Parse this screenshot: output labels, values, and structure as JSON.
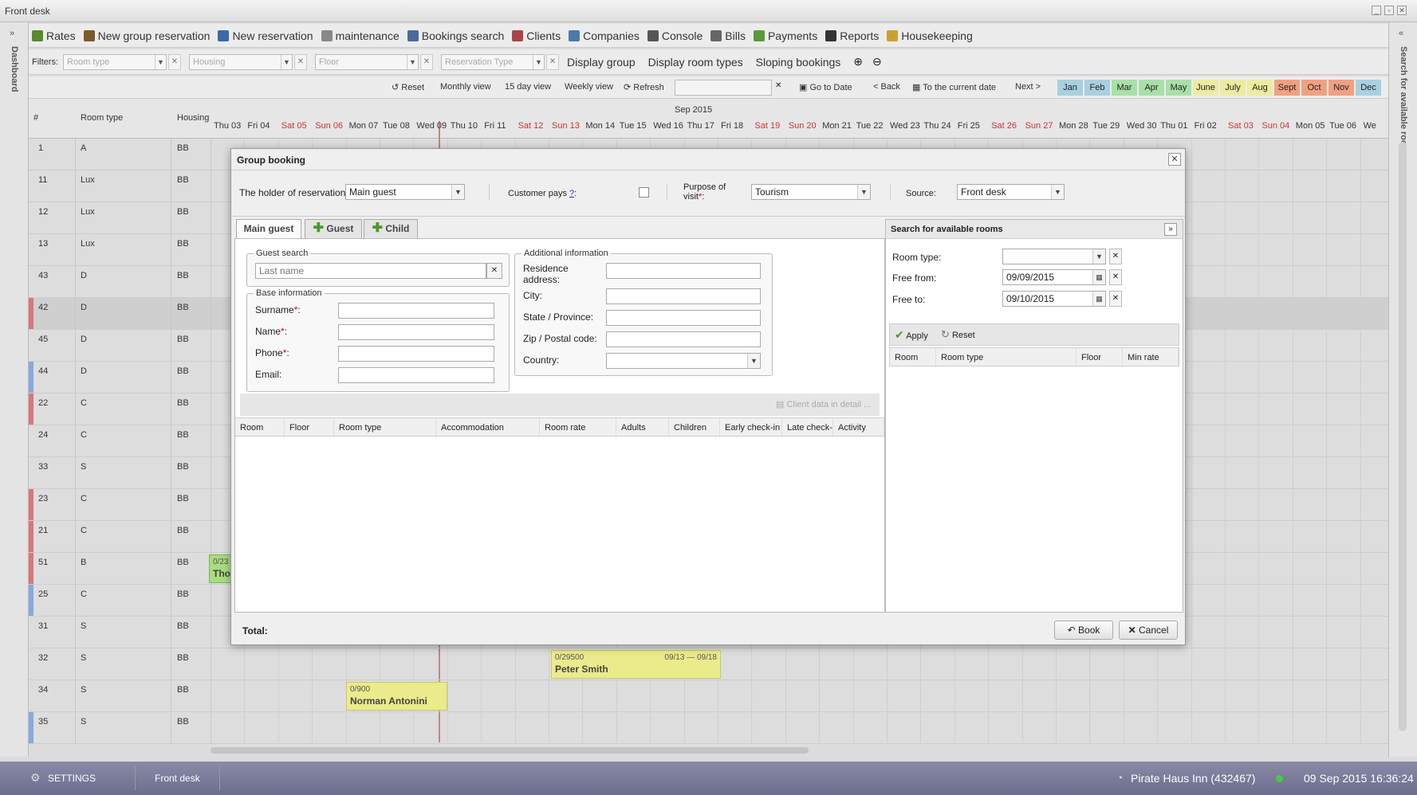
{
  "window": {
    "title": "Front desk"
  },
  "sidebars": {
    "left_label": "Dashboard",
    "right_label": "Search for available rooms"
  },
  "toolbar": {
    "items": [
      {
        "label": "Rates",
        "icon": "rates-icon",
        "color": "#5a8a2a"
      },
      {
        "label": "New group reservation",
        "icon": "group-icon",
        "color": "#7a5a2a"
      },
      {
        "label": "New reservation",
        "icon": "pen-icon",
        "color": "#3a6aaa"
      },
      {
        "label": "maintenance",
        "icon": "wrench-icon",
        "color": "#888888"
      },
      {
        "label": "Bookings search",
        "icon": "search-icon",
        "color": "#4a6a9a"
      },
      {
        "label": "Clients",
        "icon": "clients-icon",
        "color": "#aa4444"
      },
      {
        "label": "Companies",
        "icon": "companies-icon",
        "color": "#4a7aaa"
      },
      {
        "label": "Console",
        "icon": "console-icon",
        "color": "#555555"
      },
      {
        "label": "Bills",
        "icon": "bills-icon",
        "color": "#666666"
      },
      {
        "label": "Payments",
        "icon": "payments-icon",
        "color": "#5a9a3a"
      },
      {
        "label": "Reports",
        "icon": "reports-icon",
        "color": "#333333"
      },
      {
        "label": "Housekeeping",
        "icon": "broom-icon",
        "color": "#c9a030"
      }
    ]
  },
  "filters": {
    "label": "Filters:",
    "room_type": "Room type",
    "housing": "Housing",
    "floor": "Floor",
    "reservation_type": "Reservation Type",
    "links": [
      "Display group",
      "Display room types",
      "Sloping bookings"
    ]
  },
  "nav": {
    "reset": "Reset",
    "monthly": "Monthly view",
    "day15": "15 day view",
    "weekly": "Weekly view",
    "refresh": "Refresh",
    "goto": "Go to Date",
    "back": "< Back",
    "current": "To the current date",
    "next": "Next >",
    "months": [
      {
        "label": "Jan",
        "bg": "#a8d0e0"
      },
      {
        "label": "Feb",
        "bg": "#a8d0e0"
      },
      {
        "label": "Mar",
        "bg": "#a8e0a8"
      },
      {
        "label": "Apr",
        "bg": "#a8e0a8"
      },
      {
        "label": "May",
        "bg": "#a8e0a8"
      },
      {
        "label": "June",
        "bg": "#ececa0"
      },
      {
        "label": "July",
        "bg": "#ececa0"
      },
      {
        "label": "Aug",
        "bg": "#ececa0"
      },
      {
        "label": "Sept",
        "bg": "#f0a080"
      },
      {
        "label": "Oct",
        "bg": "#f0a080"
      },
      {
        "label": "Nov",
        "bg": "#f0a080"
      },
      {
        "label": "Dec",
        "bg": "#a8d0e0"
      }
    ]
  },
  "grid": {
    "month_label": "Sep 2015",
    "col_num": "#",
    "col_room_type": "Room type",
    "col_housing": "Housing",
    "days": [
      {
        "label": "Thu 03",
        "weekend": false
      },
      {
        "label": "Fri 04",
        "weekend": false
      },
      {
        "label": "Sat 05",
        "weekend": true
      },
      {
        "label": "Sun 06",
        "weekend": true
      },
      {
        "label": "Mon 07",
        "weekend": false
      },
      {
        "label": "Tue 08",
        "weekend": false
      },
      {
        "label": "Wed 09",
        "weekend": false
      },
      {
        "label": "Thu 10",
        "weekend": false
      },
      {
        "label": "Fri 11",
        "weekend": false
      },
      {
        "label": "Sat 12",
        "weekend": true
      },
      {
        "label": "Sun 13",
        "weekend": true
      },
      {
        "label": "Mon 14",
        "weekend": false
      },
      {
        "label": "Tue 15",
        "weekend": false
      },
      {
        "label": "Wed 16",
        "weekend": false
      },
      {
        "label": "Thu 17",
        "weekend": false
      },
      {
        "label": "Fri 18",
        "weekend": false
      },
      {
        "label": "Sat 19",
        "weekend": true
      },
      {
        "label": "Sun 20",
        "weekend": true
      },
      {
        "label": "Mon 21",
        "weekend": false
      },
      {
        "label": "Tue 22",
        "weekend": false
      },
      {
        "label": "Wed 23",
        "weekend": false
      },
      {
        "label": "Thu 24",
        "weekend": false
      },
      {
        "label": "Fri 25",
        "weekend": false
      },
      {
        "label": "Sat 26",
        "weekend": true
      },
      {
        "label": "Sun 27",
        "weekend": true
      },
      {
        "label": "Mon 28",
        "weekend": false
      },
      {
        "label": "Tue 29",
        "weekend": false
      },
      {
        "label": "Wed 30",
        "weekend": false
      },
      {
        "label": "Thu 01",
        "weekend": false
      },
      {
        "label": "Fri 02",
        "weekend": false
      },
      {
        "label": "Sat 03",
        "weekend": true
      },
      {
        "label": "Sun 04",
        "weekend": true
      },
      {
        "label": "Mon 05",
        "weekend": false
      },
      {
        "label": "Tue 06",
        "weekend": false
      },
      {
        "label": "We",
        "weekend": false
      }
    ],
    "rows": [
      {
        "num": "1",
        "type": "A",
        "housing": "BB",
        "marker": ""
      },
      {
        "num": "11",
        "type": "Lux",
        "housing": "BB",
        "marker": ""
      },
      {
        "num": "12",
        "type": "Lux",
        "housing": "BB",
        "marker": ""
      },
      {
        "num": "13",
        "type": "Lux",
        "housing": "BB",
        "marker": ""
      },
      {
        "num": "43",
        "type": "D",
        "housing": "BB",
        "marker": ""
      },
      {
        "num": "42",
        "type": "D",
        "housing": "BB",
        "marker": "#d9777a"
      },
      {
        "num": "45",
        "type": "D",
        "housing": "BB",
        "marker": ""
      },
      {
        "num": "44",
        "type": "D",
        "housing": "BB",
        "marker": "#8aa8dd"
      },
      {
        "num": "22",
        "type": "C",
        "housing": "BB",
        "marker": "#d9777a"
      },
      {
        "num": "24",
        "type": "C",
        "housing": "BB",
        "marker": ""
      },
      {
        "num": "33",
        "type": "S",
        "housing": "BB",
        "marker": ""
      },
      {
        "num": "23",
        "type": "C",
        "housing": "BB",
        "marker": "#d9777a"
      },
      {
        "num": "21",
        "type": "C",
        "housing": "BB",
        "marker": "#d9777a"
      },
      {
        "num": "51",
        "type": "B",
        "housing": "BB",
        "marker": "#d9777a"
      },
      {
        "num": "25",
        "type": "C",
        "housing": "BB",
        "marker": "#8aa8dd"
      },
      {
        "num": "31",
        "type": "S",
        "housing": "BB",
        "marker": ""
      },
      {
        "num": "32",
        "type": "S",
        "housing": "BB",
        "marker": ""
      },
      {
        "num": "34",
        "type": "S",
        "housing": "BB",
        "marker": ""
      },
      {
        "num": "35",
        "type": "S",
        "housing": "BB",
        "marker": "#8aa8dd"
      }
    ],
    "reservations": [
      {
        "price": "0/29500",
        "dates": "09/13 — 09/18",
        "name": "Peter Smith"
      },
      {
        "price": "0/900",
        "dates": "",
        "name": "Norman Antonini"
      },
      {
        "price": "0/23",
        "dates": "",
        "name": "Tho"
      }
    ]
  },
  "dialog": {
    "title": "Group booking",
    "holder_label": "The holder of reservation",
    "holder_value": "Main guest",
    "customer_pays_label": "Customer pays",
    "customer_pays_help": "?",
    "purpose_label": "Purpose of visit",
    "purpose_value": "Tourism",
    "source_label": "Source:",
    "source_value": "Front desk",
    "tabs": [
      "Main guest",
      "Guest",
      "Child"
    ],
    "guest_search_legend": "Guest search",
    "last_name_placeholder": "Last name",
    "base_info_legend": "Base information",
    "surname_label": "Surname",
    "name_label": "Name",
    "phone_label": "Phone",
    "email_label": "Email:",
    "additional_legend": "Additional information",
    "residence_label": "Residence address:",
    "city_label": "City:",
    "state_label": "State / Province:",
    "zip_label": "Zip / Postal code:",
    "country_label": "Country:",
    "client_data_btn": "Client data in detail ...",
    "table_columns": [
      "Room",
      "Floor",
      "Room type",
      "Accommodation",
      "Room rate",
      "Adults",
      "Children",
      "Early check-in",
      "Late check-",
      "Activity"
    ],
    "total_label": "Total:",
    "book_label": "Book",
    "cancel_label": "Cancel",
    "search_panel": {
      "title": "Search for available rooms",
      "room_type_label": "Room type:",
      "free_from_label": "Free from:",
      "free_from_value": "09/09/2015",
      "free_to_label": "Free to:",
      "free_to_value": "09/10/2015",
      "apply_label": "Apply",
      "reset_label": "Reset",
      "columns": [
        "Room",
        "Room type",
        "Floor",
        "Min rate"
      ]
    }
  },
  "statusbar": {
    "settings": "SETTINGS",
    "front_desk": "Front desk",
    "hotel": "Pirate Haus Inn (432467)",
    "datetime": "09 Sep 2015 16:36:24"
  },
  "colors": {
    "weekend": "#d33333",
    "accent_arrow": "#6a9a3a",
    "status_online": "#44cc44"
  }
}
